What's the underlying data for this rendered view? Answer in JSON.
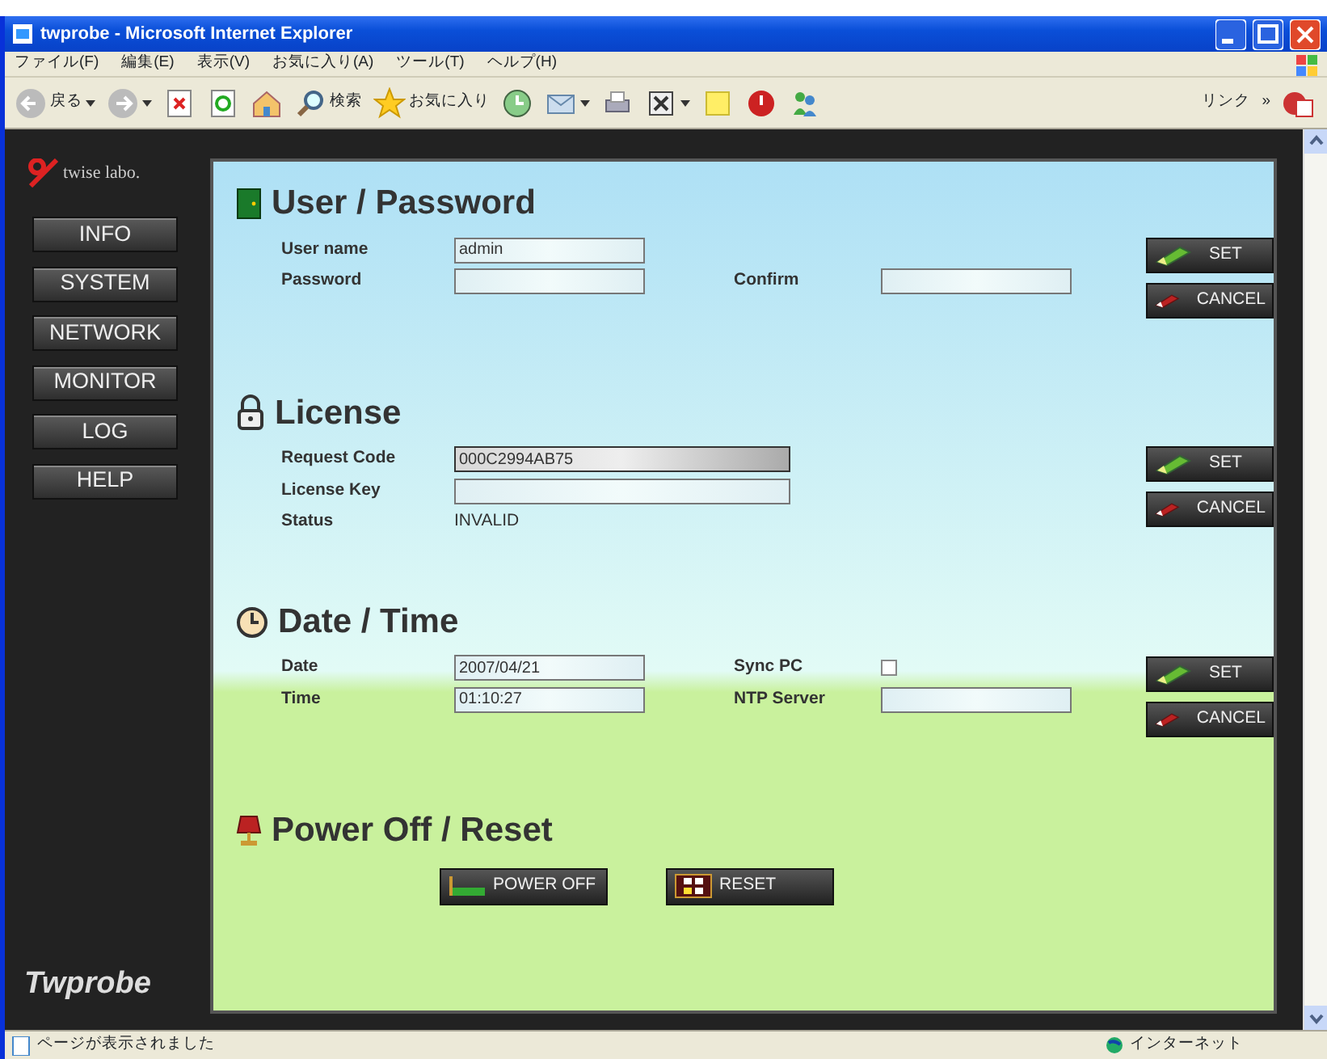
{
  "window": {
    "title": "twprobe - Microsoft Internet Explorer"
  },
  "menu": [
    "ファイル(F)",
    "編集(E)",
    "表示(V)",
    "お気に入り(A)",
    "ツール(T)",
    "ヘルプ(H)"
  ],
  "toolbar": [
    {
      "kind": "back",
      "label": "戻る",
      "dropdown": true
    },
    {
      "kind": "forward",
      "dropdown": true
    },
    {
      "kind": "stop"
    },
    {
      "kind": "refresh"
    },
    {
      "kind": "home"
    },
    {
      "kind": "search",
      "label": "検索"
    },
    {
      "kind": "star",
      "label": "お気に入り"
    },
    {
      "kind": "history"
    },
    {
      "kind": "mail",
      "dropdown": true
    },
    {
      "kind": "print"
    },
    {
      "kind": "edit",
      "dropdown": true
    },
    {
      "kind": "note"
    },
    {
      "kind": "power"
    },
    {
      "kind": "people"
    }
  ],
  "links": {
    "label": "リンク",
    "chevron": "»"
  },
  "sidebar": {
    "logo": "twise labo.",
    "items": [
      "INFO",
      "SYSTEM",
      "NETWORK",
      "MONITOR",
      "LOG",
      "HELP"
    ],
    "brand": "Twprobe"
  },
  "sections": [
    {
      "kind": "door",
      "title": "User / Password",
      "rows": [
        [
          {
            "label": "User name",
            "kind": "input",
            "value": "admin"
          }
        ],
        [
          {
            "label": "Password",
            "kind": "input"
          },
          {
            "label": "Confirm",
            "kind": "input"
          }
        ]
      ],
      "buttons": [
        "SET",
        "CANCEL"
      ]
    },
    {
      "kind": "lock",
      "title": "License",
      "rows": [
        [
          {
            "label": "Request Code",
            "kind": "readonly",
            "value": "000C2994AB75"
          }
        ],
        [
          {
            "label": "License Key",
            "kind": "long-input"
          }
        ],
        [
          {
            "label": "Status",
            "kind": "text",
            "value": "INVALID"
          }
        ]
      ],
      "buttons": [
        "SET",
        "CANCEL"
      ]
    },
    {
      "kind": "clock",
      "title": "Date / Time",
      "rows": [
        [
          {
            "label": "Date",
            "kind": "input",
            "value": "2007/04/21"
          },
          {
            "label": "Sync PC",
            "kind": "checkbox",
            "checked": false
          }
        ],
        [
          {
            "label": "Time",
            "kind": "input",
            "value": "01:10:27"
          },
          {
            "label": "NTP Server",
            "kind": "input"
          }
        ]
      ],
      "buttons": [
        "SET",
        "CANCEL"
      ]
    },
    {
      "kind": "lamp",
      "title": "Power Off / Reset",
      "actions": [
        {
          "kind": "power",
          "label": "POWER OFF"
        },
        {
          "kind": "reset",
          "label": "RESET"
        }
      ]
    }
  ],
  "status_bar": {
    "text": "ページが表示されました",
    "zone": "インターネット"
  }
}
